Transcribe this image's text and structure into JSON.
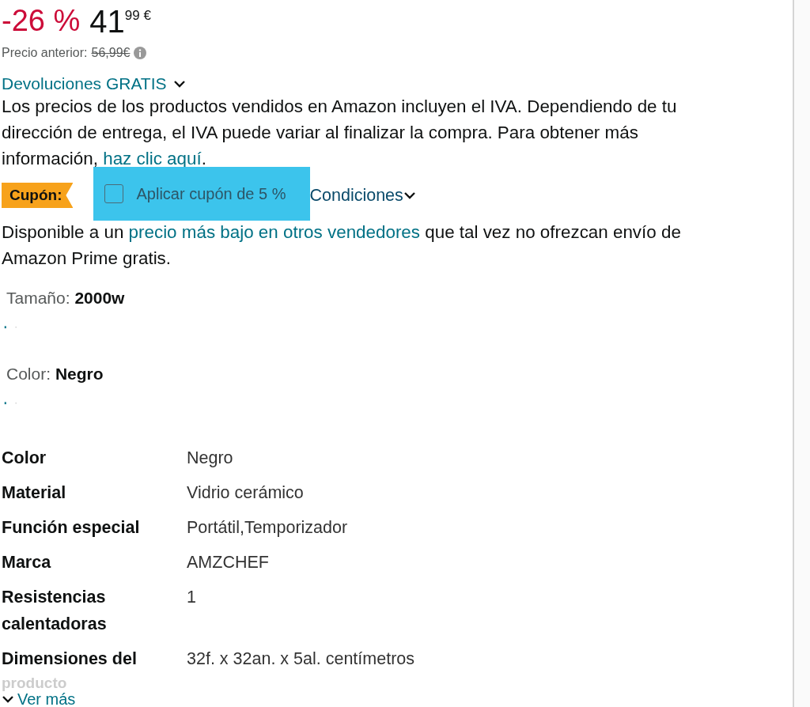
{
  "price": {
    "discount": "-26 %",
    "whole": "41",
    "fraction": "99",
    "currency": "€",
    "previous_label": "Precio anterior:",
    "previous_value": "56,99€"
  },
  "returns": {
    "label": "Devoluciones GRATIS"
  },
  "tax_note": {
    "text": "Los precios de los productos vendidos en Amazon incluyen el IVA. Dependiendo de tu dirección de entrega, el IVA puede variar al finalizar la compra. Para obtener más información, ",
    "link": "haz clic aquí",
    "end": "."
  },
  "coupon": {
    "badge": "Cupón:",
    "label": "Aplicar cupón de 5 %",
    "checked": false,
    "highlighted": true,
    "terms": "Condiciones"
  },
  "other_sellers": {
    "before": "Disponible a un ",
    "link": "precio más bajo en otros vendedores",
    "after": " que tal vez no ofrezcan envío de Amazon Prime gratis."
  },
  "variations": [
    {
      "label": "Tamaño:",
      "value": "2000w"
    },
    {
      "label": "Color:",
      "value": "Negro"
    }
  ],
  "specs": [
    {
      "name": "Color",
      "value": "Negro"
    },
    {
      "name": "Material",
      "value": "Vidrio cerámico"
    },
    {
      "name": "Función especial",
      "value": "Portátil,Temporizador"
    },
    {
      "name": "Marca",
      "value": "AMZCHEF"
    },
    {
      "name": "Resistencias calentadoras",
      "value": "1"
    },
    {
      "name": "Dimensiones del",
      "value": "32f. x 32an. x 5al. centímetros"
    }
  ],
  "faded_text": "producto",
  "see_more": "Ver más"
}
